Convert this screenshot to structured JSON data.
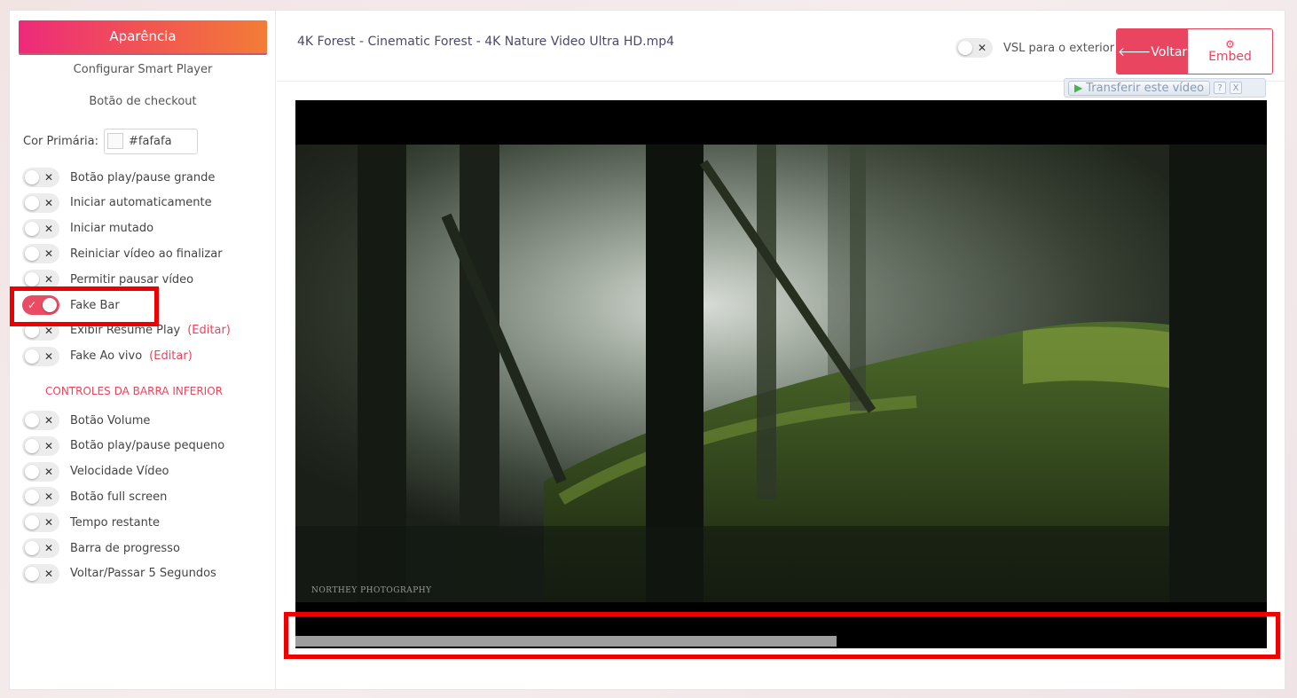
{
  "sidebar": {
    "appearance_label": "Aparência",
    "configure_label": "Configurar Smart Player",
    "checkout_label": "Botão de checkout",
    "primary_color_label": "Cor Primária:",
    "primary_color_value": "#fafafa",
    "toggles": [
      {
        "label": "Botão play/pause grande",
        "on": false
      },
      {
        "label": "Iniciar automaticamente",
        "on": false
      },
      {
        "label": "Iniciar mutado",
        "on": false
      },
      {
        "label": "Reiniciar vídeo ao finalizar",
        "on": false
      },
      {
        "label": "Permitir pausar vídeo",
        "on": false
      },
      {
        "label": "Fake Bar",
        "on": true
      },
      {
        "label": "Exibir Resume Play",
        "on": false,
        "edit": "(Editar)"
      },
      {
        "label": "Fake Ao vivo",
        "on": false,
        "edit": "(Editar)"
      }
    ],
    "bottom_section_title": "CONTROLES DA BARRA INFERIOR",
    "bottom_toggles": [
      {
        "label": "Botão Volume",
        "on": false
      },
      {
        "label": "Botão play/pause pequeno",
        "on": false
      },
      {
        "label": "Velocidade Vídeo",
        "on": false
      },
      {
        "label": "Botão full screen",
        "on": false
      },
      {
        "label": "Tempo restante",
        "on": false
      },
      {
        "label": "Barra de progresso",
        "on": false
      },
      {
        "label": "Voltar/Passar 5 Segundos",
        "on": false
      }
    ]
  },
  "header": {
    "video_title": "4K Forest - Cinematic Forest - 4K Nature Video Ultra HD.mp4",
    "vsl_label": "VSL para o exterior",
    "back_label": "🡐Voltar",
    "embed_label": "Embed",
    "download_label": "Transferir este vídeo",
    "download_help": "?",
    "download_close": "X"
  },
  "player": {
    "watermark": "NORTHEY PHOTOGRAPHY",
    "fake_progress": 0.557
  },
  "colors": {
    "accent": "#ea4d63",
    "highlight": "#ee0000"
  }
}
